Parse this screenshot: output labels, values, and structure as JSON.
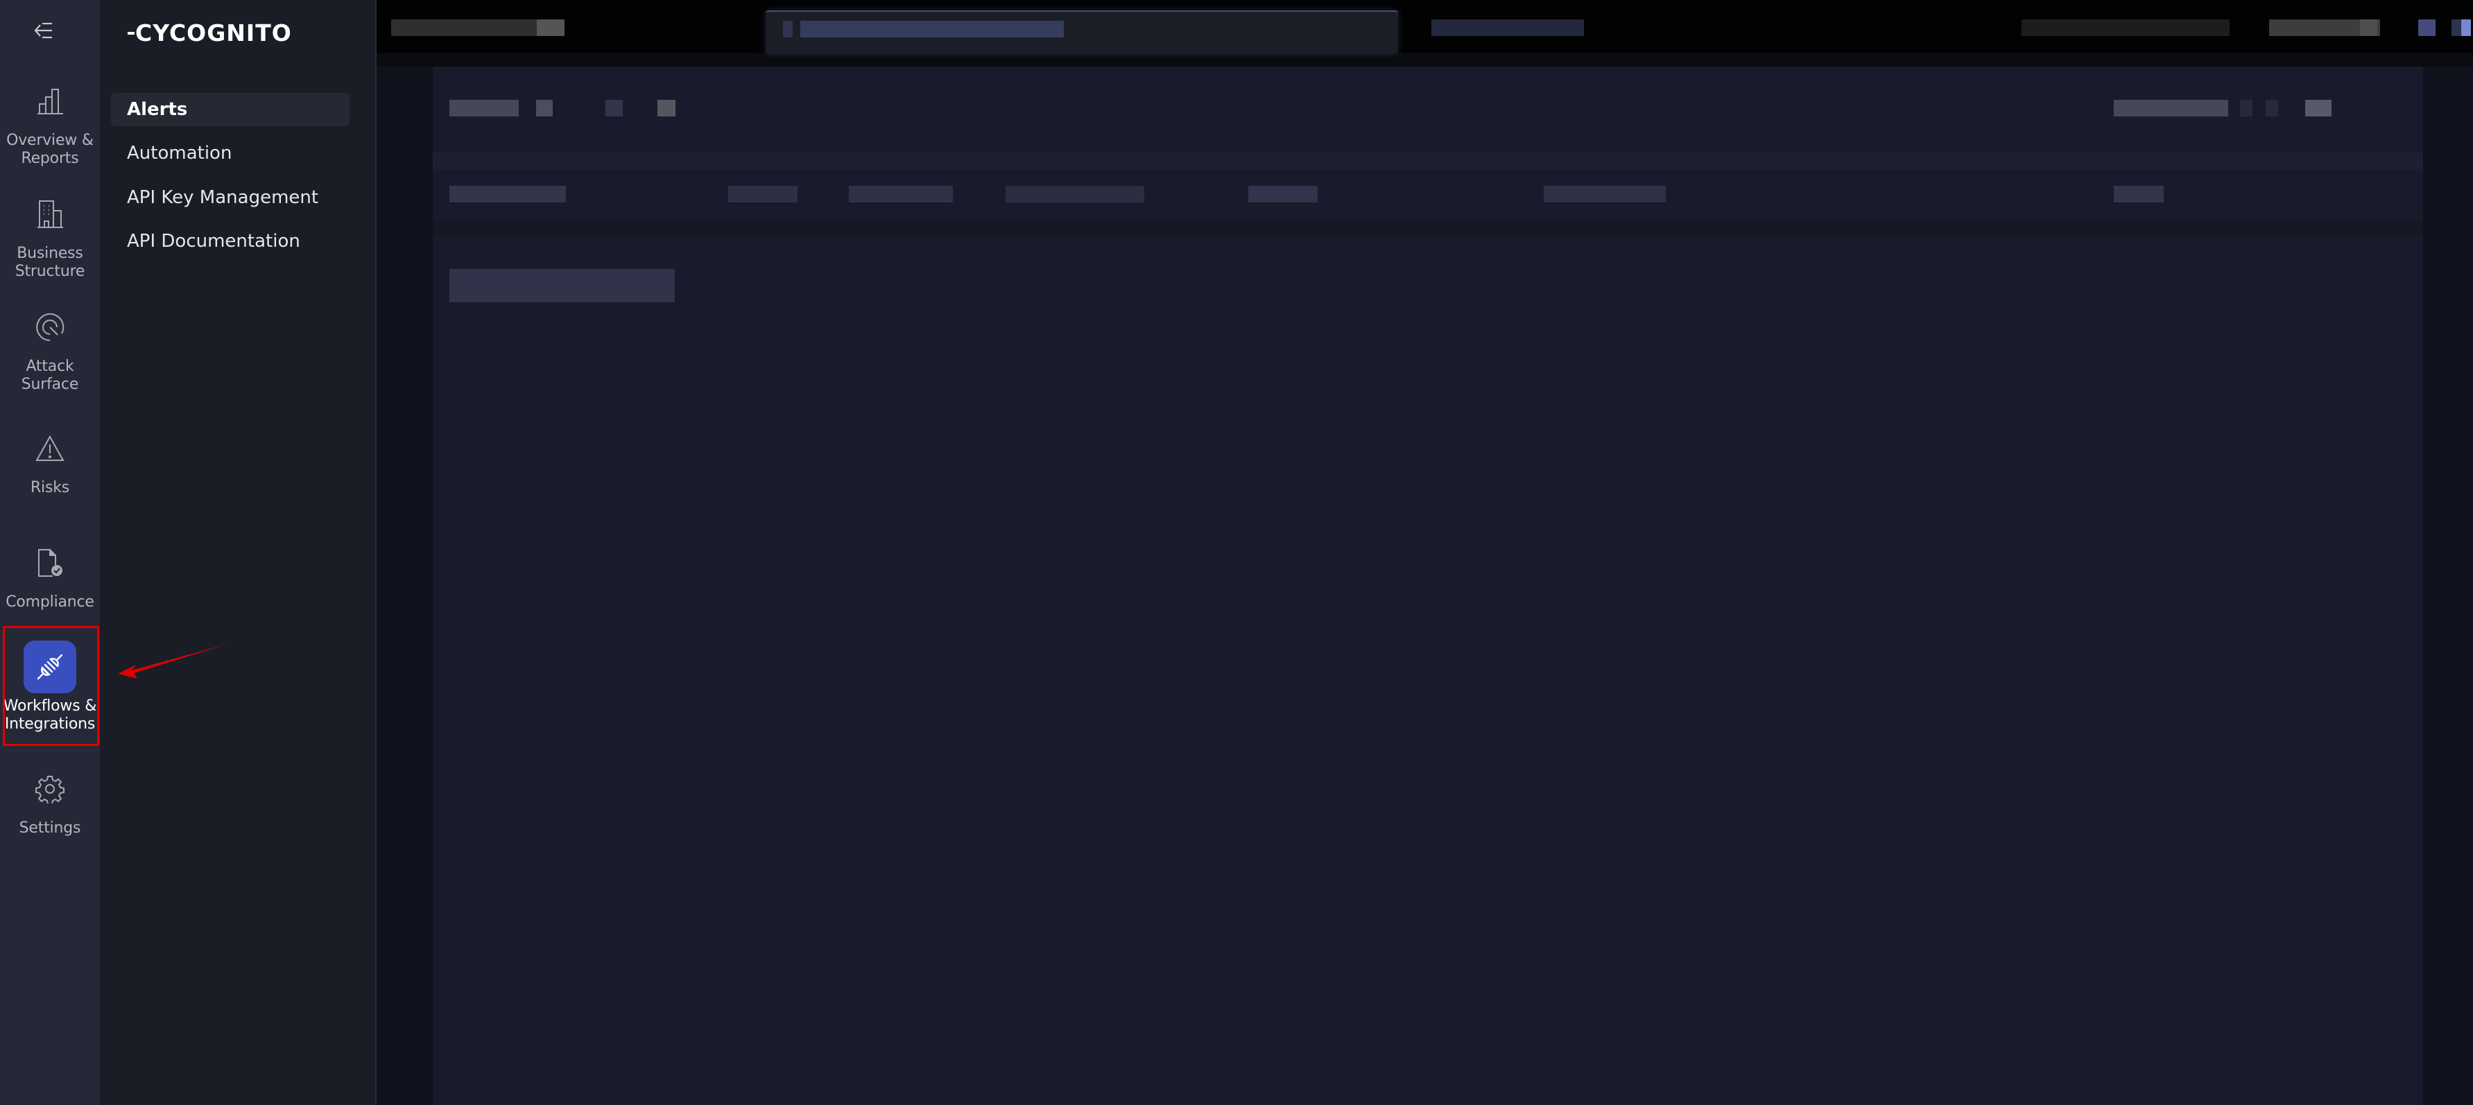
{
  "rail": {
    "collapse_icon": "collapse-left-icon",
    "items": [
      {
        "label": "Overview &\nReports",
        "icon": "bar-chart-icon",
        "active": false
      },
      {
        "label": "Business\nStructure",
        "icon": "building-icon",
        "active": false
      },
      {
        "label": "Attack\nSurface",
        "icon": "radar-icon",
        "active": false
      },
      {
        "label": "Risks",
        "icon": "warning-triangle-icon",
        "active": false
      },
      {
        "label": "Compliance",
        "icon": "document-check-icon",
        "active": false
      },
      {
        "label": "Workflows &\nIntegrations",
        "icon": "plug-icon",
        "active": true
      },
      {
        "label": "Settings",
        "icon": "gear-icon",
        "active": false
      }
    ]
  },
  "subnav": {
    "logo": "CYCOGNITO",
    "items": [
      {
        "label": "Alerts",
        "active": true
      },
      {
        "label": "Automation",
        "active": false
      },
      {
        "label": "API Key Management",
        "active": false
      },
      {
        "label": "API Documentation",
        "active": false
      }
    ]
  },
  "topbar": {
    "redacted": true
  },
  "main": {
    "redacted": true
  },
  "colors": {
    "accent": "#3a4fbf",
    "annotation": "#e00000",
    "rail_bg": "#252836",
    "subnav_bg": "#1b1d26",
    "panel_bg": "#181b2b"
  }
}
